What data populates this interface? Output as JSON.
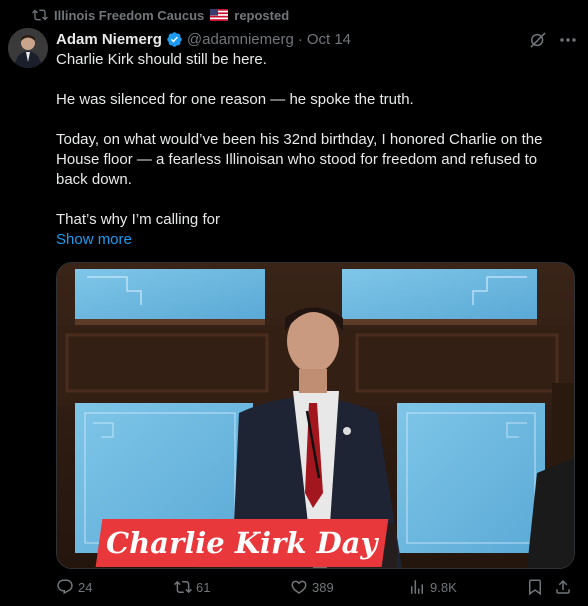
{
  "repost": {
    "text": "Illinois Freedom Caucus",
    "suffix": "reposted",
    "flag": "us-flag-emoji"
  },
  "author": {
    "name": "Adam Niemerg",
    "handle": "@adamniemerg",
    "separator": "·",
    "date": "Oct 14",
    "verified": true
  },
  "tweet": {
    "paragraphs": [
      "Charlie Kirk should still be here.",
      "He was silenced for one reason — he spoke the truth.",
      "Today, on what would’ve been his 32nd birthday, I honored Charlie on the House floor — a fearless Illinoisan who stood for freedom and refused to back down.",
      "That’s why I’m calling for"
    ],
    "show_more": "Show more"
  },
  "media": {
    "caption": "Charlie Kirk Day"
  },
  "actions": {
    "replies": "24",
    "reposts": "61",
    "likes": "389",
    "views": "9.8K"
  },
  "colors": {
    "background": "#000000",
    "text": "#e7e9ea",
    "muted": "#71767b",
    "link": "#1d9bf0",
    "caption_bg": "#e8383b",
    "verified": "#1d9bf0"
  },
  "icons": [
    "repost-icon",
    "verified-badge-icon",
    "grok-icon",
    "more-icon",
    "reply-icon",
    "retweet-icon",
    "like-icon",
    "views-icon",
    "bookmark-icon",
    "share-icon"
  ]
}
